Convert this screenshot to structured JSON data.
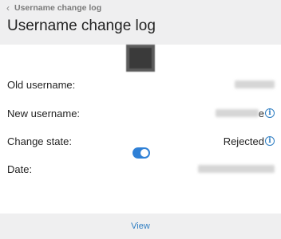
{
  "header": {
    "back_icon": "chevron-left-icon",
    "breadcrumb": "Username change log",
    "title": "Username change log"
  },
  "record": {
    "avatar_icon": "avatar-image",
    "old_username": {
      "label": "Old username:",
      "value": ""
    },
    "new_username": {
      "label": "New username:",
      "value_suffix": "e",
      "info_icon": "info-icon",
      "info_glyph": "i"
    },
    "change_state": {
      "label": "Change state:",
      "value": "Rejected",
      "info_icon": "info-icon",
      "info_glyph": "i"
    },
    "date": {
      "label": "Date:",
      "value": ""
    },
    "toggle": {
      "state": "on",
      "accent": "#2f80d6"
    }
  },
  "footer": {
    "view_label": "View",
    "link_color": "#2f7ec2"
  }
}
